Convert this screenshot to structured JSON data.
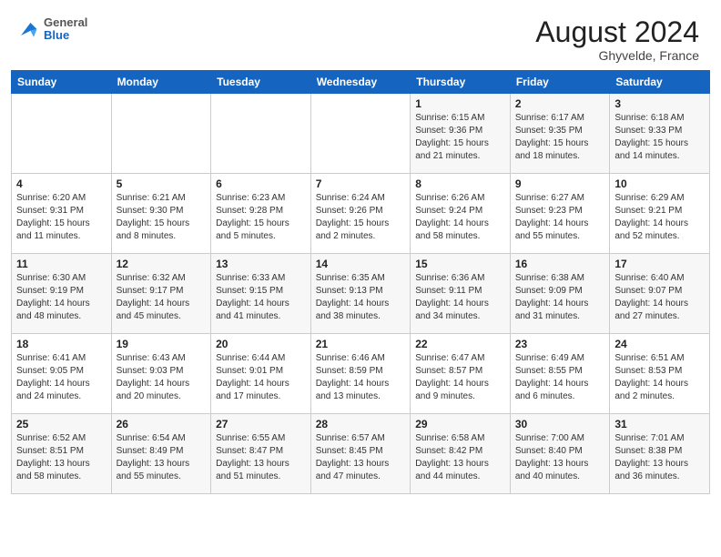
{
  "header": {
    "logo_general": "General",
    "logo_blue": "Blue",
    "month_title": "August 2024",
    "location": "Ghyvelde, France"
  },
  "calendar": {
    "days_of_week": [
      "Sunday",
      "Monday",
      "Tuesday",
      "Wednesday",
      "Thursday",
      "Friday",
      "Saturday"
    ],
    "weeks": [
      [
        {
          "num": "",
          "info": ""
        },
        {
          "num": "",
          "info": ""
        },
        {
          "num": "",
          "info": ""
        },
        {
          "num": "",
          "info": ""
        },
        {
          "num": "1",
          "info": "Sunrise: 6:15 AM\nSunset: 9:36 PM\nDaylight: 15 hours\nand 21 minutes."
        },
        {
          "num": "2",
          "info": "Sunrise: 6:17 AM\nSunset: 9:35 PM\nDaylight: 15 hours\nand 18 minutes."
        },
        {
          "num": "3",
          "info": "Sunrise: 6:18 AM\nSunset: 9:33 PM\nDaylight: 15 hours\nand 14 minutes."
        }
      ],
      [
        {
          "num": "4",
          "info": "Sunrise: 6:20 AM\nSunset: 9:31 PM\nDaylight: 15 hours\nand 11 minutes."
        },
        {
          "num": "5",
          "info": "Sunrise: 6:21 AM\nSunset: 9:30 PM\nDaylight: 15 hours\nand 8 minutes."
        },
        {
          "num": "6",
          "info": "Sunrise: 6:23 AM\nSunset: 9:28 PM\nDaylight: 15 hours\nand 5 minutes."
        },
        {
          "num": "7",
          "info": "Sunrise: 6:24 AM\nSunset: 9:26 PM\nDaylight: 15 hours\nand 2 minutes."
        },
        {
          "num": "8",
          "info": "Sunrise: 6:26 AM\nSunset: 9:24 PM\nDaylight: 14 hours\nand 58 minutes."
        },
        {
          "num": "9",
          "info": "Sunrise: 6:27 AM\nSunset: 9:23 PM\nDaylight: 14 hours\nand 55 minutes."
        },
        {
          "num": "10",
          "info": "Sunrise: 6:29 AM\nSunset: 9:21 PM\nDaylight: 14 hours\nand 52 minutes."
        }
      ],
      [
        {
          "num": "11",
          "info": "Sunrise: 6:30 AM\nSunset: 9:19 PM\nDaylight: 14 hours\nand 48 minutes."
        },
        {
          "num": "12",
          "info": "Sunrise: 6:32 AM\nSunset: 9:17 PM\nDaylight: 14 hours\nand 45 minutes."
        },
        {
          "num": "13",
          "info": "Sunrise: 6:33 AM\nSunset: 9:15 PM\nDaylight: 14 hours\nand 41 minutes."
        },
        {
          "num": "14",
          "info": "Sunrise: 6:35 AM\nSunset: 9:13 PM\nDaylight: 14 hours\nand 38 minutes."
        },
        {
          "num": "15",
          "info": "Sunrise: 6:36 AM\nSunset: 9:11 PM\nDaylight: 14 hours\nand 34 minutes."
        },
        {
          "num": "16",
          "info": "Sunrise: 6:38 AM\nSunset: 9:09 PM\nDaylight: 14 hours\nand 31 minutes."
        },
        {
          "num": "17",
          "info": "Sunrise: 6:40 AM\nSunset: 9:07 PM\nDaylight: 14 hours\nand 27 minutes."
        }
      ],
      [
        {
          "num": "18",
          "info": "Sunrise: 6:41 AM\nSunset: 9:05 PM\nDaylight: 14 hours\nand 24 minutes."
        },
        {
          "num": "19",
          "info": "Sunrise: 6:43 AM\nSunset: 9:03 PM\nDaylight: 14 hours\nand 20 minutes."
        },
        {
          "num": "20",
          "info": "Sunrise: 6:44 AM\nSunset: 9:01 PM\nDaylight: 14 hours\nand 17 minutes."
        },
        {
          "num": "21",
          "info": "Sunrise: 6:46 AM\nSunset: 8:59 PM\nDaylight: 14 hours\nand 13 minutes."
        },
        {
          "num": "22",
          "info": "Sunrise: 6:47 AM\nSunset: 8:57 PM\nDaylight: 14 hours\nand 9 minutes."
        },
        {
          "num": "23",
          "info": "Sunrise: 6:49 AM\nSunset: 8:55 PM\nDaylight: 14 hours\nand 6 minutes."
        },
        {
          "num": "24",
          "info": "Sunrise: 6:51 AM\nSunset: 8:53 PM\nDaylight: 14 hours\nand 2 minutes."
        }
      ],
      [
        {
          "num": "25",
          "info": "Sunrise: 6:52 AM\nSunset: 8:51 PM\nDaylight: 13 hours\nand 58 minutes."
        },
        {
          "num": "26",
          "info": "Sunrise: 6:54 AM\nSunset: 8:49 PM\nDaylight: 13 hours\nand 55 minutes."
        },
        {
          "num": "27",
          "info": "Sunrise: 6:55 AM\nSunset: 8:47 PM\nDaylight: 13 hours\nand 51 minutes."
        },
        {
          "num": "28",
          "info": "Sunrise: 6:57 AM\nSunset: 8:45 PM\nDaylight: 13 hours\nand 47 minutes."
        },
        {
          "num": "29",
          "info": "Sunrise: 6:58 AM\nSunset: 8:42 PM\nDaylight: 13 hours\nand 44 minutes."
        },
        {
          "num": "30",
          "info": "Sunrise: 7:00 AM\nSunset: 8:40 PM\nDaylight: 13 hours\nand 40 minutes."
        },
        {
          "num": "31",
          "info": "Sunrise: 7:01 AM\nSunset: 8:38 PM\nDaylight: 13 hours\nand 36 minutes."
        }
      ]
    ]
  }
}
